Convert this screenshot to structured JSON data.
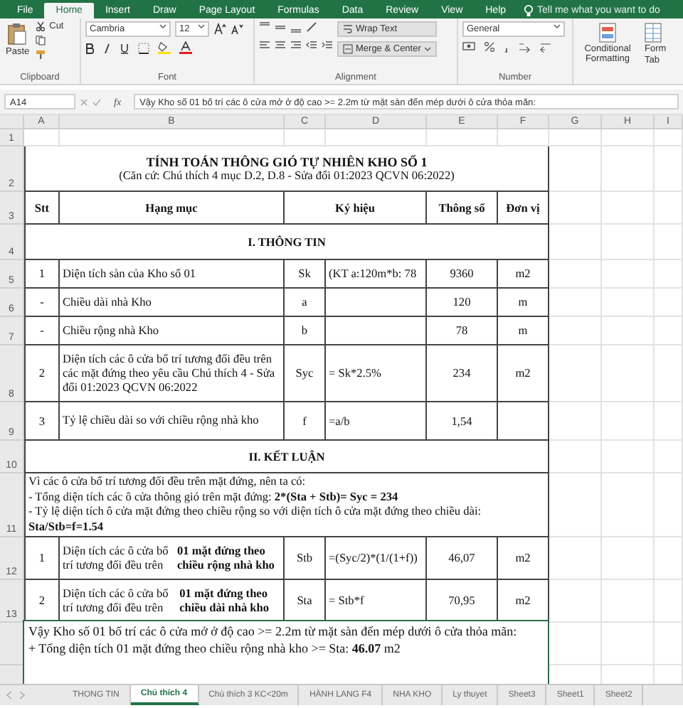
{
  "menu_tabs": [
    {
      "label": "File",
      "selected": false
    },
    {
      "label": "Home",
      "selected": true
    },
    {
      "label": "Insert",
      "selected": false
    },
    {
      "label": "Draw",
      "selected": false
    },
    {
      "label": "Page Layout",
      "selected": false
    },
    {
      "label": "Formulas",
      "selected": false
    },
    {
      "label": "Data",
      "selected": false
    },
    {
      "label": "Review",
      "selected": false
    },
    {
      "label": "View",
      "selected": false
    },
    {
      "label": "Help",
      "selected": false
    }
  ],
  "tell_me": {
    "placeholder": "Tell me what you want to do"
  },
  "ribbon": {
    "clipboard": {
      "paste": "Paste",
      "cut": "Cut",
      "label": "Clipboard"
    },
    "font": {
      "name": "Cambria",
      "size": "12",
      "label": "Font"
    },
    "alignment": {
      "wrap_text": "Wrap Text",
      "merge": "Merge & Center",
      "label": "Alignment"
    },
    "number": {
      "format": "General",
      "label": "Number"
    },
    "styles": {
      "conditional": "Conditional Formatting",
      "format_table_1": "Form",
      "format_table_2": "Tab"
    }
  },
  "formula_bar": {
    "cell": "A14",
    "fx": "fx",
    "value": "Vậy Kho số 01 bố trí các ô cửa mở ở độ cao >= 2.2m từ mặt sàn đến mép dưới ô cửa thỏa mãn:"
  },
  "sheet": {
    "columns": [
      "A",
      "B",
      "C",
      "D",
      "E",
      "F",
      "G",
      "H",
      "I"
    ],
    "rows": [
      {
        "number": "1",
        "kind": "blank"
      },
      {
        "number": "2",
        "kind": "title",
        "title": "TÍNH TOÁN THÔNG GIÓ TỰ NHIÊN KHO SỐ 1",
        "subtitle": "(Căn cứ: Chú thích 4 mục D.2, D.8 - Sửa đổi 01:2023 QCVN 06:2022)"
      },
      {
        "number": "3",
        "kind": "header",
        "cells": [
          "Stt",
          "Hạng mục",
          "Ký hiệu",
          "Thông số",
          "Đơn vị"
        ]
      },
      {
        "number": "4",
        "kind": "section",
        "text": "I. THÔNG TIN"
      },
      {
        "number": "5",
        "kind": "data",
        "cells": [
          "1",
          "Diện tích sàn của Kho số 01",
          "Sk",
          "(KT a:120m*b: 78",
          "9360",
          "m2"
        ]
      },
      {
        "number": "6",
        "kind": "data",
        "cells": [
          "-",
          "Chiều dài nhà Kho",
          "a",
          "",
          "120",
          "m"
        ]
      },
      {
        "number": "7",
        "kind": "data",
        "cells": [
          "-",
          "Chiều rộng nhà Kho",
          "b",
          "",
          "78",
          "m"
        ]
      },
      {
        "number": "8",
        "kind": "data",
        "cells": [
          "2",
          "Diện tích các ô cửa bố trí tương đối đều trên các mặt đứng theo yêu cầu Chú thích 4 - Sửa đổi 01:2023 QCVN 06:2022",
          "Syc",
          "= Sk*2.5%",
          "234",
          "m2"
        ]
      },
      {
        "number": "9",
        "kind": "data",
        "cells": [
          "3",
          "Tỷ lệ chiều dài so với chiều rộng nhà kho",
          "f",
          "=a/b",
          "1,54",
          ""
        ]
      },
      {
        "number": "10",
        "kind": "section",
        "text": "II. KẾT LUẬN"
      },
      {
        "number": "11",
        "kind": "note",
        "lines": [
          {
            "text": "Vì các ô cửa bố trí tương đối đều trên mặt đứng, nên ta có:",
            "bold": false
          },
          {
            "text": "- Tổng diện tích các ô cửa thông gió trên mặt đứng:  **2*(Sta + Stb)= Syc = 234**",
            "bold": false
          },
          {
            "text": "- Tỷ lệ diện tích ô cửa mặt đứng theo chiều rộng so với diện tích ô cửa mặt đứng theo chiều dài:",
            "bold": false
          },
          {
            "text": "Sta/Stb=f=1.54",
            "bold": true
          }
        ]
      },
      {
        "number": "12",
        "kind": "data",
        "cells": [
          "1",
          "Diện tích các ô cửa bố trí tương đối đều trên **01 mặt đứng theo chiều rộng nhà kho**",
          "Stb",
          "=(Syc/2)*(1/(1+f))",
          "46,07",
          "m2"
        ]
      },
      {
        "number": "13",
        "kind": "data",
        "cells": [
          "2",
          "Diện tích các ô cửa bố trí tương đối đều trên **01 mặt đứng theo chiều dài nhà kho**",
          "Sta",
          "= Stb*f",
          "70,95",
          "m2"
        ]
      }
    ]
  },
  "text_box": {
    "lines": [
      "Vậy Kho số 01 bố trí các ô cửa mở ở độ cao >= 2.2m từ mặt sàn đến mép dưới ô cửa thỏa mãn:",
      "+ Tổng diện tích 01 mặt đứng theo chiều rộng nhà kho >= Sta: **46.07** m2"
    ]
  },
  "sheet_tabs": [
    {
      "label": "THONG TIN",
      "selected": false
    },
    {
      "label": "Chú thích 4",
      "selected": true
    },
    {
      "label": "Chú thích 3 KC<20m",
      "selected": false
    },
    {
      "label": "HÀNH LANG F4",
      "selected": false
    },
    {
      "label": "NHA KHO",
      "selected": false
    },
    {
      "label": "Ly thuyet",
      "selected": false
    },
    {
      "label": "Sheet3",
      "selected": false
    },
    {
      "label": "Sheet1",
      "selected": false
    },
    {
      "label": "Sheet2",
      "selected": false
    }
  ]
}
